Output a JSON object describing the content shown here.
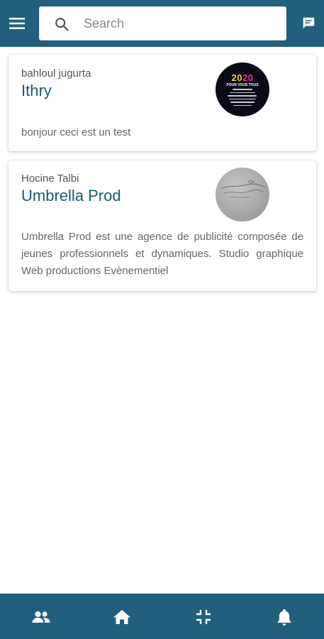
{
  "colors": {
    "primary": "#215f7d",
    "title": "#1f5a78",
    "text_muted": "#666666"
  },
  "header": {
    "menu_icon": "menu-icon",
    "search": {
      "icon": "search-icon",
      "placeholder": "Search",
      "value": ""
    },
    "chat_icon": "chat-icon"
  },
  "posts": [
    {
      "author": "bahloul jugurta",
      "title": "Ithry",
      "description": "bonjour ceci est un test",
      "thumbnail": {
        "year_left": "20",
        "year_right": "20",
        "caption": "POUR VOUS TOUS"
      }
    },
    {
      "author": "Hocine Talbi",
      "title": "Umbrella Prod",
      "description": "Umbrella Prod est une agence de publicité composée de jeunes professionnels et dynamiques. Studio graphique Web productions Evènementiel",
      "thumbnail": {}
    }
  ],
  "bottom_nav": [
    {
      "icon": "people-icon",
      "selected": false
    },
    {
      "icon": "home-icon",
      "selected": true
    },
    {
      "icon": "collapse-icon",
      "selected": false
    },
    {
      "icon": "bell-icon",
      "selected": false
    }
  ]
}
